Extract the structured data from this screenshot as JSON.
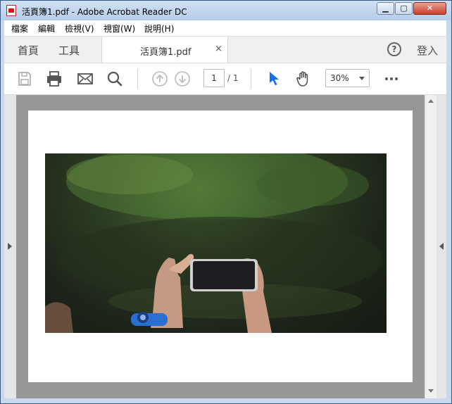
{
  "window": {
    "title": "活頁簿1.pdf - Adobe Acrobat Reader DC"
  },
  "menu": {
    "items": [
      "檔案",
      "編輯",
      "檢視(V)",
      "視窗(W)",
      "說明(H)"
    ]
  },
  "tabs": {
    "home": "首頁",
    "tools": "工具",
    "document": "活頁簿1.pdf",
    "close": "×",
    "login": "登入"
  },
  "toolbar": {
    "icons": [
      "save-icon",
      "print-icon",
      "email-icon",
      "search-icon",
      "prev-page-icon",
      "next-page-icon",
      "select-cursor-icon",
      "hand-tool-icon",
      "more-icon"
    ],
    "page_current": "1",
    "page_total": "/ 1",
    "zoom": "30%",
    "accent": "#1473e6"
  },
  "document": {
    "content": "photo of hands holding a smartphone in front of green foliage"
  }
}
